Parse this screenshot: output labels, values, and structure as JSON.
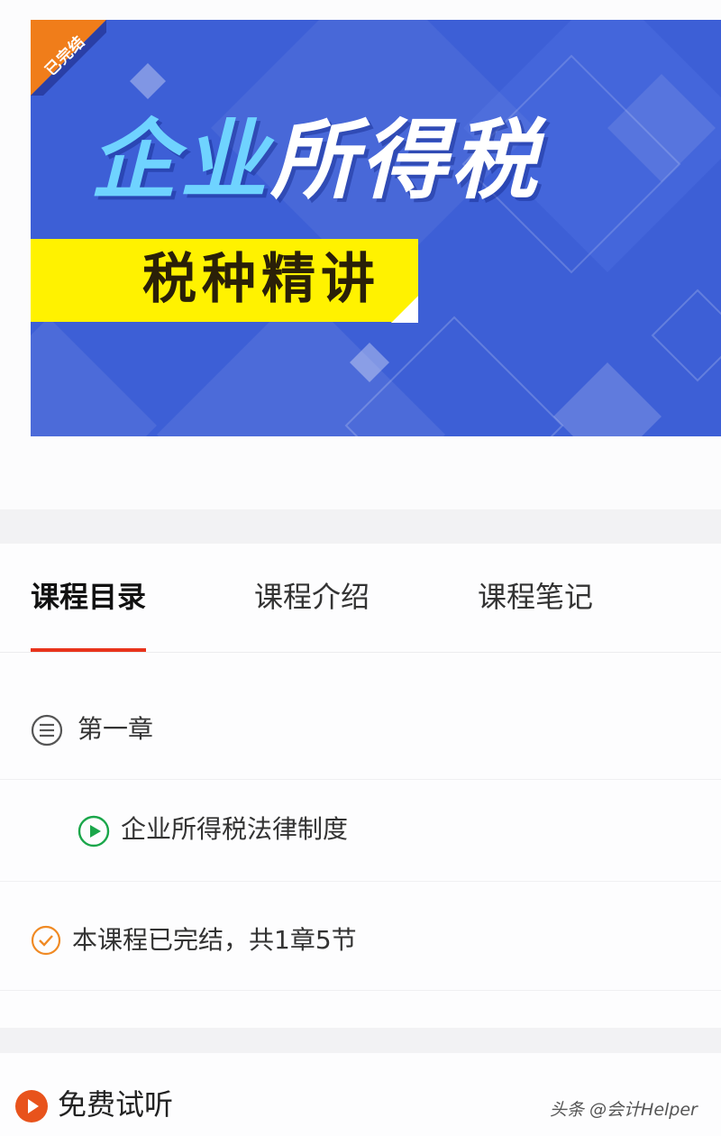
{
  "banner": {
    "badge": "已完结",
    "title": "企业所得税",
    "subtitle": "税种精讲",
    "colors": {
      "background": "#3d5fd6",
      "highlight": "#fff200",
      "badge": "#f07d1a",
      "title_accent": "#6fd3ff"
    }
  },
  "tabs": [
    {
      "label": "课程目录",
      "active": true
    },
    {
      "label": "课程介绍",
      "active": false
    },
    {
      "label": "课程笔记",
      "active": false
    }
  ],
  "catalog": {
    "chapter": {
      "label": "第一章",
      "icon": "list-circle-icon"
    },
    "lesson": {
      "label": "企业所得税法律制度",
      "icon": "play-circle-icon"
    },
    "status": {
      "label": "本课程已完结，共1章5节",
      "icon": "check-circle-icon"
    }
  },
  "footer": {
    "trial_label": "免费试听",
    "trial_icon": "play-icon",
    "watermark": "头条 @会计Helper"
  },
  "accent_color": "#e8341c"
}
